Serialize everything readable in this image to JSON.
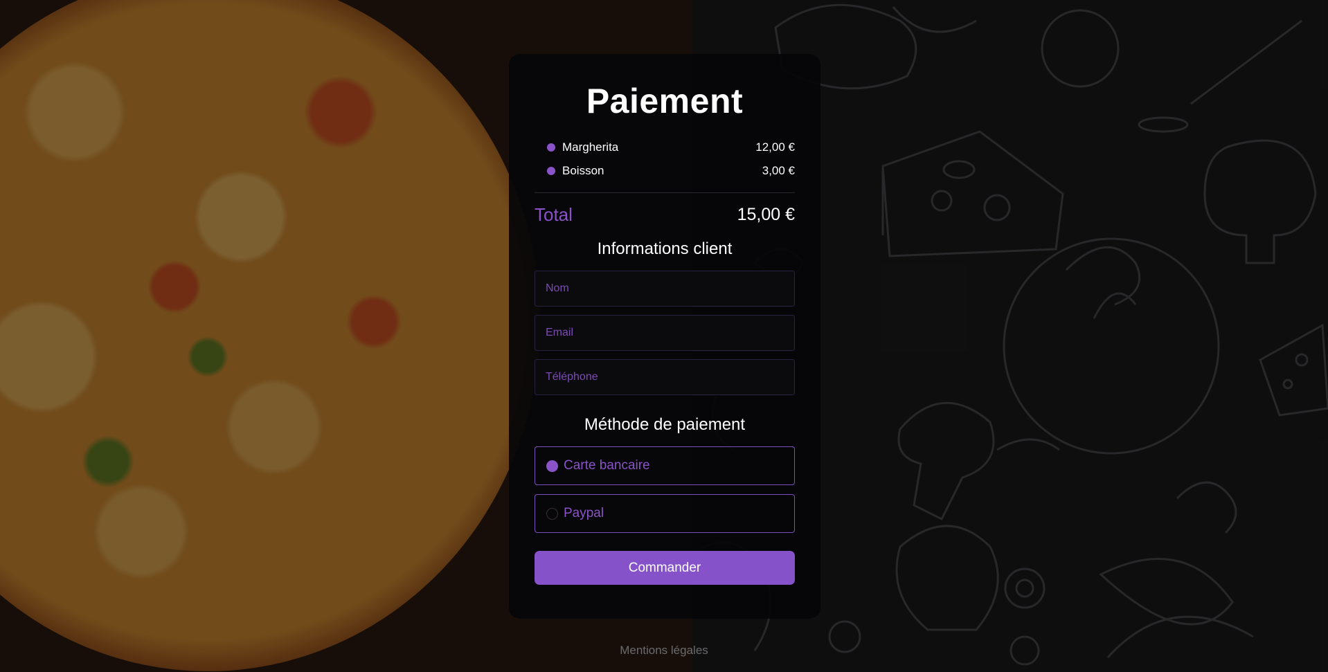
{
  "page": {
    "title": "Paiement",
    "accent_color": "#8a54c8",
    "background_left": "pizza photo",
    "background_right": "food doodle pattern"
  },
  "order": {
    "items": [
      {
        "name": "Margherita",
        "price": "12,00 €"
      },
      {
        "name": "Boisson",
        "price": "3,00 €"
      }
    ],
    "total_label": "Total",
    "total_value": "15,00 €"
  },
  "customer": {
    "section_title": "Informations client",
    "fields": {
      "name_placeholder": "Nom",
      "email_placeholder": "Email",
      "phone_placeholder": "Téléphone"
    }
  },
  "payment": {
    "section_title": "Méthode de paiement",
    "options": [
      {
        "label": "Carte bancaire",
        "selected": true
      },
      {
        "label": "Paypal",
        "selected": false
      }
    ]
  },
  "actions": {
    "submit_label": "Commander"
  },
  "footer": {
    "legal_link": "Mentions légales"
  }
}
